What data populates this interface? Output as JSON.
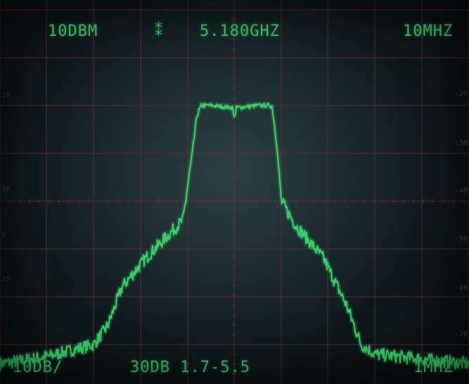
{
  "display": {
    "ref_level": "10DBM",
    "marker_symbol": "⁑",
    "center_freq": "5.180GHZ",
    "span_per_div": "10MHZ",
    "vertical_scale": "10DB/",
    "attenuation_range": "30DB 1.7-5.5",
    "resolution_bw": "1MHZ"
  },
  "scale_labels": {
    "right": [
      "-20",
      "-30",
      "-40",
      "-50",
      "-60",
      "-70"
    ],
    "left": [
      "10",
      "30",
      "5",
      "35"
    ]
  },
  "trace": {
    "color": "#39d46b",
    "description": "Channelized RF spectrum trace at 5.180 GHz with a flat-top occupied band"
  },
  "grid_color": "#6e2f37",
  "chart_data": {
    "type": "line",
    "title": "",
    "xlabel": "",
    "ylabel": "",
    "x_units": "divisions",
    "y_units": "dB",
    "xlim": [
      0,
      10
    ],
    "ylim": [
      -80,
      10
    ],
    "series": [
      {
        "x": [
          0,
          1.0,
          2.0,
          2.3,
          2.6,
          3.1,
          3.6,
          3.9,
          4.1,
          4.2,
          4.3,
          4.5,
          5.0,
          5.5,
          5.8,
          5.9,
          6.0,
          6.3,
          6.9,
          7.4,
          7.7,
          8.0,
          9.0,
          10.0
        ],
        "y": [
          -64,
          -62.5,
          -60,
          -56,
          -48,
          -42,
          -37,
          -34,
          -20,
          -12,
          -10,
          -10,
          -10.5,
          -10,
          -10,
          -18,
          -30,
          -35,
          -42,
          -52,
          -60,
          -62,
          -63,
          -64
        ]
      }
    ]
  }
}
